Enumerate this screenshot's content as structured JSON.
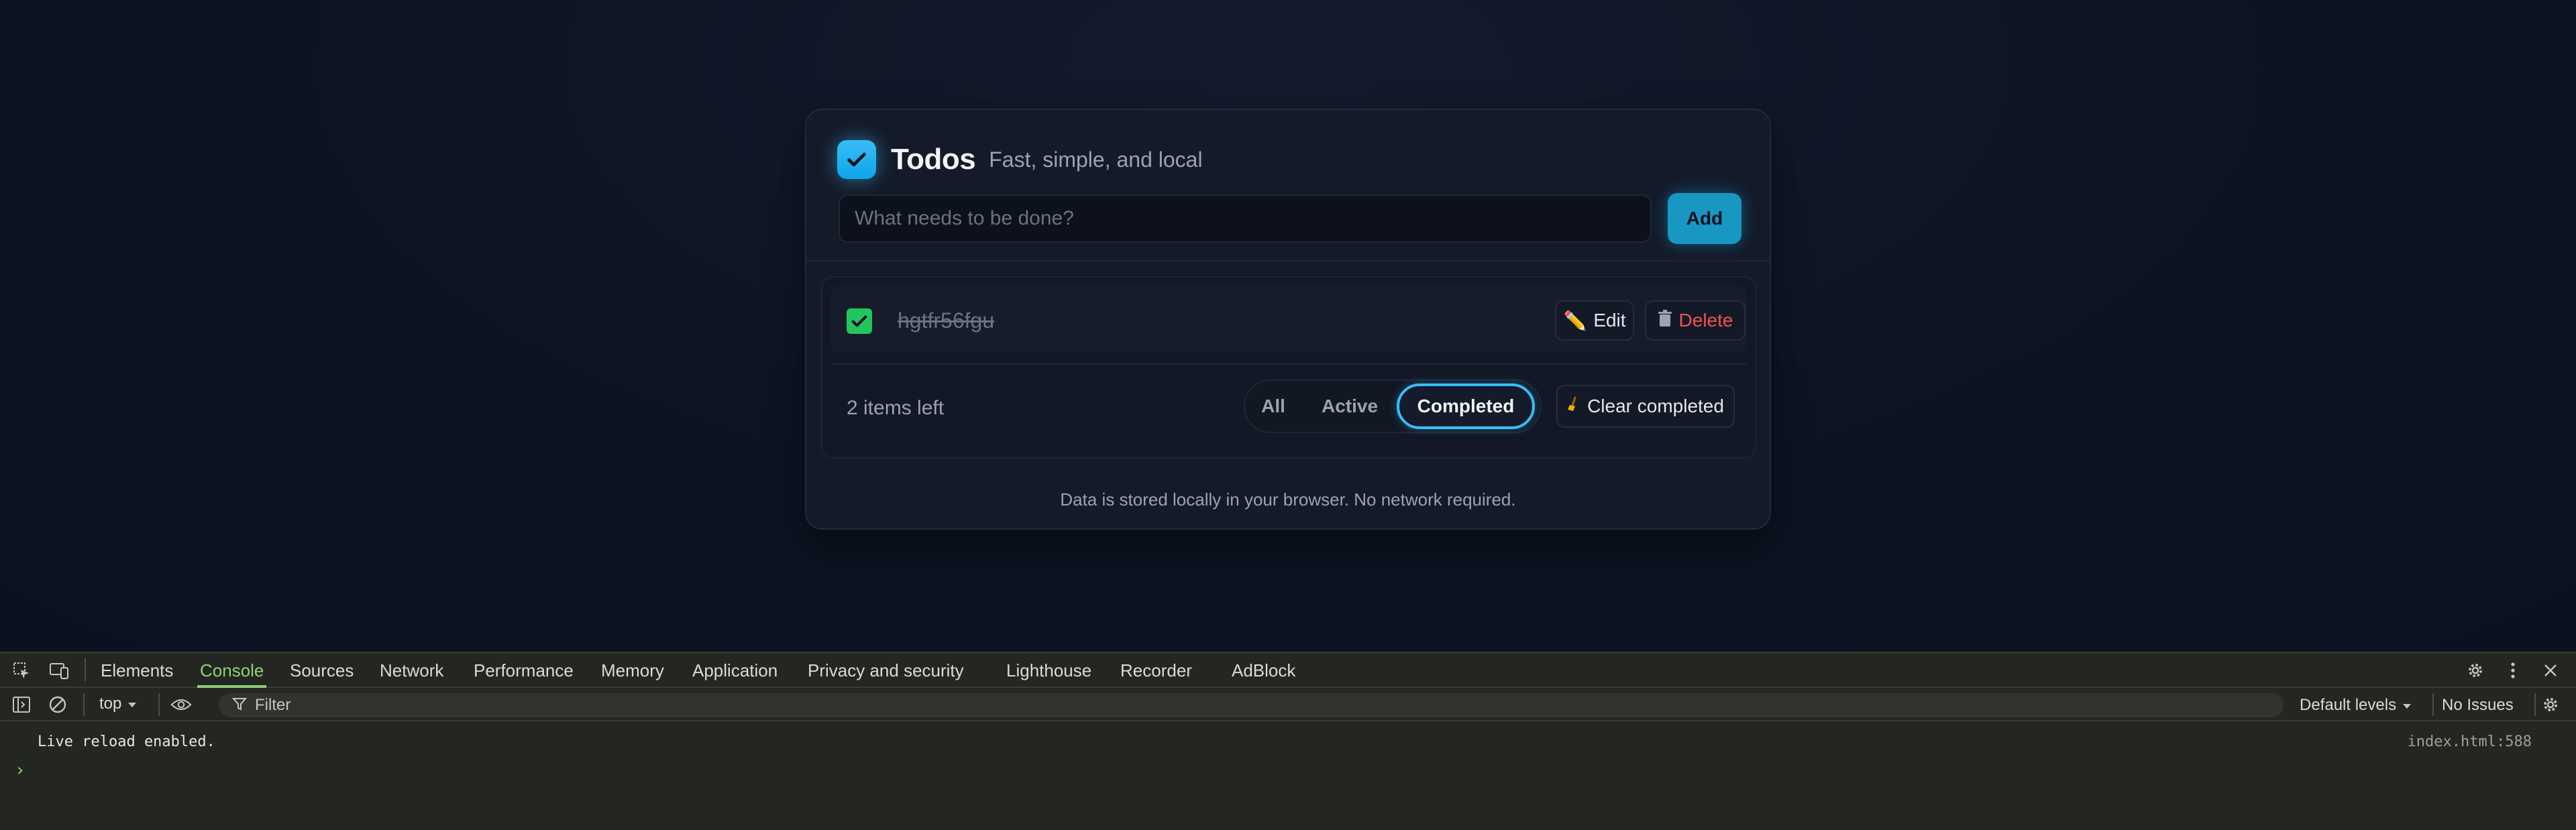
{
  "app": {
    "title": "Todos",
    "subtitle": "Fast, simple, and local",
    "new_todo": {
      "placeholder": "What needs to be done?",
      "value": ""
    },
    "add_label": "Add",
    "todos": [
      {
        "text": "hgtfr56fgu",
        "completed": true,
        "edit_label": "Edit",
        "delete_label": "Delete"
      }
    ],
    "items_left": "2 items left",
    "filters": [
      {
        "label": "All",
        "selected": false
      },
      {
        "label": "Active",
        "selected": false
      },
      {
        "label": "Completed",
        "selected": true
      }
    ],
    "clear_completed_label": "Clear completed",
    "footer_note": "Data is stored locally in your browser. No network required.",
    "colors": {
      "accent": "#38bdf8",
      "check": "#22c55e",
      "danger": "#f05252",
      "background": "#0f1525"
    }
  },
  "devtools": {
    "tabs": [
      "Elements",
      "Console",
      "Sources",
      "Network",
      "Performance",
      "Memory",
      "Application",
      "Privacy and security",
      "Lighthouse",
      "Recorder",
      "AdBlock"
    ],
    "active_tab": "Console",
    "context": "top",
    "filter_placeholder": "Filter",
    "levels": "Default levels",
    "issues": "No Issues",
    "messages": [
      {
        "text": "Live reload enabled.",
        "source": "index.html:588"
      }
    ],
    "prompt": "›",
    "icons": [
      "inspect-icon",
      "device-toolbar-icon",
      "settings-icon",
      "more-icon",
      "close-icon",
      "sidebar-icon",
      "clear-icon",
      "eye-icon",
      "filter-icon"
    ]
  }
}
